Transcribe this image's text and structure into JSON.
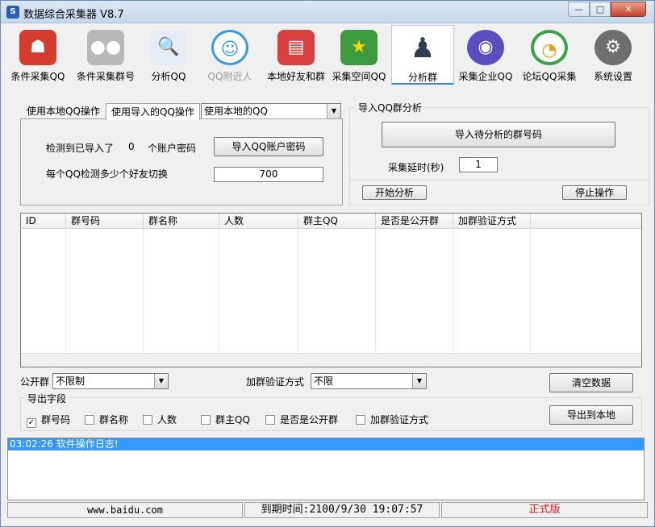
{
  "window": {
    "title": "数据综合采集器 V8.7"
  },
  "toolbar": {
    "items": [
      {
        "label": "条件采集QQ",
        "icon": "robot-icon",
        "color": "#d63b2f"
      },
      {
        "label": "条件采集群号",
        "icon": "users-icon",
        "color": "#b0b0b0"
      },
      {
        "label": "分析QQ",
        "icon": "magnifier-doc-icon",
        "color": "#4a88c8"
      },
      {
        "label": "QQ附近人",
        "icon": "location-person-icon",
        "color": "#3a9ae0"
      },
      {
        "label": "本地好友和群",
        "icon": "book-person-icon",
        "color": "#d84040"
      },
      {
        "label": "采集空间QQ",
        "icon": "star-icon",
        "color": "#3e9a3e"
      },
      {
        "label": "分析群",
        "icon": "group-silhouette-icon",
        "color": "#2c3e50"
      },
      {
        "label": "采集企业QQ",
        "icon": "globe-icon",
        "color": "#5b4fc0"
      },
      {
        "label": "论坛QQ采集",
        "icon": "forum-icon",
        "color": "#e8a020"
      },
      {
        "label": "系统设置",
        "icon": "gear-icon",
        "color": "#6e6e6e"
      }
    ]
  },
  "tabs": {
    "local": "使用本地QQ操作",
    "imported": "使用导入的QQ操作"
  },
  "qq_source": {
    "selected": "使用本地的QQ"
  },
  "import_panel": {
    "detected_prefix": "检测到已导入了",
    "detected_count": "0",
    "detected_suffix": "个账户密码",
    "import_button": "导入QQ账户密码",
    "switch_label": "每个QQ检测多少个好友切换",
    "switch_value": "700"
  },
  "group_analysis": {
    "title": "导入QQ群分析",
    "import_button": "导入待分析的群号码",
    "delay_label": "采集延时(秒)",
    "delay_value": "1",
    "start_button": "开始分析",
    "stop_button": "停止操作"
  },
  "table": {
    "columns": [
      "ID",
      "群号码",
      "群名称",
      "人数",
      "群主QQ",
      "是否是公开群",
      "加群验证方式"
    ]
  },
  "filters": {
    "public_label": "公开群",
    "public_value": "不限制",
    "verify_label": "加群验证方式",
    "verify_value": "不限",
    "clear_button": "清空数据"
  },
  "export": {
    "title": "导出字段",
    "fields": [
      {
        "label": "群号码",
        "checked": true,
        "mark": "✓"
      },
      {
        "label": "群名称",
        "checked": false,
        "mark": ""
      },
      {
        "label": "人数",
        "checked": false,
        "mark": ""
      },
      {
        "label": "群主QQ",
        "checked": false,
        "mark": ""
      },
      {
        "label": "是否是公开群",
        "checked": false,
        "mark": ""
      },
      {
        "label": "加群验证方式",
        "checked": false,
        "mark": ""
      }
    ],
    "export_button": "导出到本地"
  },
  "log": {
    "lines": [
      "03:02:26 软件操作日志!"
    ]
  },
  "status": {
    "site": "www.baidu.com",
    "expiry": "到期时间:2100/9/30 19:07:57",
    "version": "正式版"
  }
}
